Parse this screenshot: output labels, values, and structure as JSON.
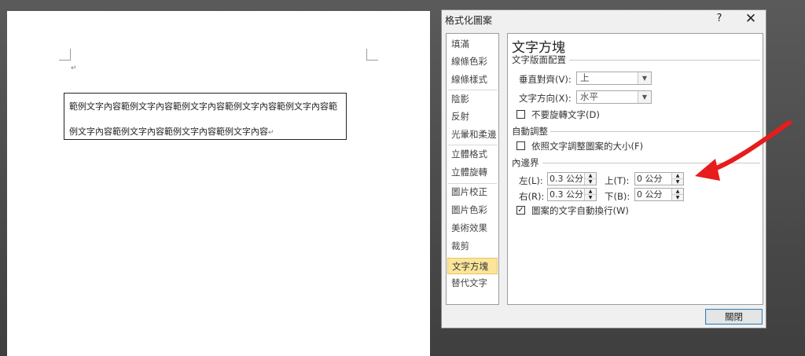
{
  "document": {
    "paragraph_mark": "↵",
    "textbox_line1": "範例文字內容範例文字內容範例文字內容範例文字內容範例文字內容範",
    "textbox_line2": "例文字內容範例文字內容範例文字內容範例文字內容",
    "textbox_end_mark": "↵"
  },
  "dialog": {
    "title": "格式化圖案",
    "help_label": "?",
    "close_label": "✕",
    "categories": [
      {
        "label": "填滿"
      },
      {
        "label": "線條色彩"
      },
      {
        "label": "線條樣式"
      },
      {
        "label": "陰影"
      },
      {
        "label": "反射"
      },
      {
        "label": "光暈和柔邊"
      },
      {
        "label": "立體格式"
      },
      {
        "label": "立體旋轉"
      },
      {
        "label": "圖片校正"
      },
      {
        "label": "圖片色彩"
      },
      {
        "label": "美術效果"
      },
      {
        "label": "裁剪"
      },
      {
        "label": "文字方塊"
      },
      {
        "label": "替代文字"
      }
    ],
    "selected_category": "文字方塊",
    "panel": {
      "title": "文字方塊",
      "layout_section": "文字版面配置",
      "vertical_align_label": "垂直對齊(V):",
      "vertical_align_value": "上",
      "text_direction_label": "文字方向(X):",
      "text_direction_value": "水平",
      "no_rotate_label": "不要旋轉文字(D)",
      "no_rotate_checked": false,
      "autofit_section": "自動調整",
      "resize_label": "依照文字調整圖案的大小(F)",
      "resize_checked": false,
      "margins_section": "內邊界",
      "left_label": "左(L):",
      "left_value": "0.3 公分",
      "top_label": "上(T):",
      "top_value": "0 公分",
      "right_label": "右(R):",
      "right_value": "0.3 公分",
      "bottom_label": "下(B):",
      "bottom_value": "0 公分",
      "wrap_label": "圖案的文字自動換行(W)",
      "wrap_checked": true,
      "check_mark": "✓"
    },
    "close_button_label": "關閉"
  },
  "icons": {
    "dropdown_arrow": "▼",
    "spin_up": "▲",
    "spin_down": "▼"
  },
  "colors": {
    "selected_category_bg": "#fbe59a",
    "annotation_arrow": "#e81c1c",
    "default_button_border": "#3c7fb1"
  }
}
